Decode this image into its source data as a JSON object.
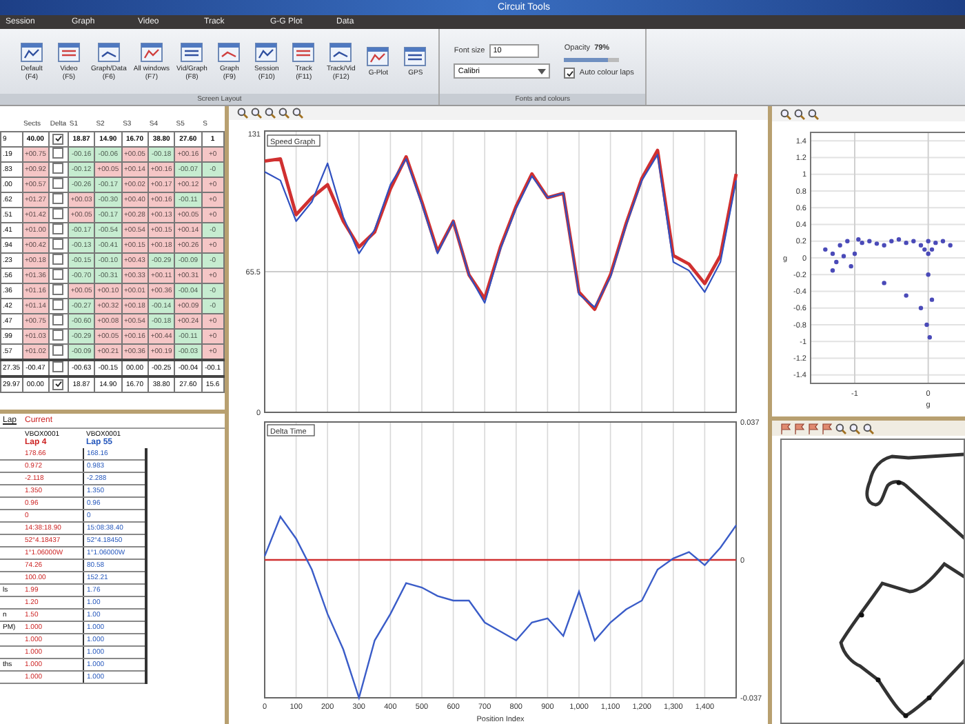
{
  "window": {
    "title": "Circuit Tools"
  },
  "menu": [
    "Session",
    "Graph",
    "Video",
    "Track",
    "G-G Plot",
    "Data"
  ],
  "layout_group": {
    "caption": "Screen Layout",
    "buttons": [
      {
        "label": "Default",
        "key": "(F4)"
      },
      {
        "label": "Video",
        "key": "(F5)"
      },
      {
        "label": "Graph/Data",
        "key": "(F6)"
      },
      {
        "label": "All windows",
        "key": "(F7)"
      },
      {
        "label": "Vid/Graph",
        "key": "(F8)"
      },
      {
        "label": "Graph",
        "key": "(F9)"
      },
      {
        "label": "Session",
        "key": "(F10)"
      },
      {
        "label": "Track",
        "key": "(F11)"
      },
      {
        "label": "Track/Vid",
        "key": "(F12)"
      },
      {
        "label": "G-Plot"
      },
      {
        "label": "GPS"
      }
    ]
  },
  "fonts_group": {
    "caption": "Fonts and colours",
    "font_size_label": "Font size",
    "font_size": "10",
    "font": "Calibri",
    "opacity_label": "Opacity",
    "opacity": "79%",
    "opacity_slider": {
      "level": 0.79
    },
    "auto_colour": {
      "label": "Auto colour laps",
      "checked": true
    }
  },
  "lap_table": {
    "columns": [
      "Sects",
      "Delta",
      "S1",
      "S2",
      "S3",
      "S4",
      "S5",
      "S"
    ],
    "best": {
      "lead": "9",
      "sects": "40.00",
      "checked": true,
      "splits": [
        "18.87",
        "14.90",
        "16.70",
        "38.80",
        "27.60",
        "1"
      ]
    },
    "rows": [
      {
        "lead": ".19",
        "sects": {
          "text": "+00.75",
          "color": "#f5c6c6"
        },
        "checked": false,
        "splits": [
          {
            "text": "-00.16",
            "color": "#c6ecd0"
          },
          {
            "text": "-00.06",
            "color": "#c6ecd0"
          },
          {
            "text": "+00.05",
            "color": "#f5c6c6"
          },
          {
            "text": "-00.18",
            "color": "#c6ecd0"
          },
          {
            "text": "+00.16",
            "color": "#f5c6c6"
          },
          {
            "text": "+0",
            "color": "#f5c6c6"
          }
        ]
      },
      {
        "lead": ".83",
        "sects": {
          "text": "+00.92",
          "color": "#f5c6c6"
        },
        "checked": false,
        "splits": [
          {
            "text": "-00.12",
            "color": "#c6ecd0"
          },
          {
            "text": "+00.05",
            "color": "#f5c6c6"
          },
          {
            "text": "+00.14",
            "color": "#f5c6c6"
          },
          {
            "text": "+00.16",
            "color": "#f5c6c6"
          },
          {
            "text": "-00.07",
            "color": "#c6ecd0"
          },
          {
            "text": "-0",
            "color": "#c6ecd0"
          }
        ]
      },
      {
        "lead": ".00",
        "sects": {
          "text": "+00.57",
          "color": "#f5c6c6"
        },
        "checked": false,
        "splits": [
          {
            "text": "-00.26",
            "color": "#c6ecd0"
          },
          {
            "text": "-00.17",
            "color": "#c6ecd0"
          },
          {
            "text": "+00.02",
            "color": "#f5c6c6"
          },
          {
            "text": "+00.17",
            "color": "#f5c6c6"
          },
          {
            "text": "+00.12",
            "color": "#f5c6c6"
          },
          {
            "text": "+0",
            "color": "#f5c6c6"
          }
        ]
      },
      {
        "lead": ".62",
        "sects": {
          "text": "+01.27",
          "color": "#f5c6c6"
        },
        "checked": false,
        "splits": [
          {
            "text": "+00.03",
            "color": "#f5c6c6"
          },
          {
            "text": "-00.30",
            "color": "#c6ecd0"
          },
          {
            "text": "+00.40",
            "color": "#f5c6c6"
          },
          {
            "text": "+00.16",
            "color": "#f5c6c6"
          },
          {
            "text": "-00.11",
            "color": "#c6ecd0"
          },
          {
            "text": "+0",
            "color": "#f5c6c6"
          }
        ]
      },
      {
        "lead": ".51",
        "sects": {
          "text": "+01.42",
          "color": "#f5c6c6"
        },
        "checked": false,
        "splits": [
          {
            "text": "+00.05",
            "color": "#f5c6c6"
          },
          {
            "text": "-00.17",
            "color": "#c6ecd0"
          },
          {
            "text": "+00.28",
            "color": "#f5c6c6"
          },
          {
            "text": "+00.13",
            "color": "#f5c6c6"
          },
          {
            "text": "+00.05",
            "color": "#f5c6c6"
          },
          {
            "text": "+0",
            "color": "#f5c6c6"
          }
        ]
      },
      {
        "lead": ".41",
        "sects": {
          "text": "+01.00",
          "color": "#f5c6c6"
        },
        "checked": false,
        "splits": [
          {
            "text": "-00.17",
            "color": "#c6ecd0"
          },
          {
            "text": "-00.54",
            "color": "#c6ecd0"
          },
          {
            "text": "+00.54",
            "color": "#f5c6c6"
          },
          {
            "text": "+00.15",
            "color": "#f5c6c6"
          },
          {
            "text": "+00.14",
            "color": "#f5c6c6"
          },
          {
            "text": "-0",
            "color": "#c6ecd0"
          }
        ]
      },
      {
        "lead": ".94",
        "sects": {
          "text": "+00.42",
          "color": "#f5c6c6"
        },
        "checked": false,
        "splits": [
          {
            "text": "-00.13",
            "color": "#c6ecd0"
          },
          {
            "text": "-00.41",
            "color": "#c6ecd0"
          },
          {
            "text": "+00.15",
            "color": "#f5c6c6"
          },
          {
            "text": "+00.18",
            "color": "#f5c6c6"
          },
          {
            "text": "+00.26",
            "color": "#f5c6c6"
          },
          {
            "text": "+0",
            "color": "#f5c6c6"
          }
        ]
      },
      {
        "lead": ".23",
        "sects": {
          "text": "+00.18",
          "color": "#f5c6c6"
        },
        "checked": false,
        "splits": [
          {
            "text": "-00.15",
            "color": "#c6ecd0"
          },
          {
            "text": "-00.10",
            "color": "#c6ecd0"
          },
          {
            "text": "+00.43",
            "color": "#f5c6c6"
          },
          {
            "text": "-00.29",
            "color": "#c6ecd0"
          },
          {
            "text": "-00.09",
            "color": "#c6ecd0"
          },
          {
            "text": "-0",
            "color": "#c6ecd0"
          }
        ]
      },
      {
        "lead": ".56",
        "sects": {
          "text": "+01.36",
          "color": "#f5c6c6"
        },
        "checked": false,
        "splits": [
          {
            "text": "-00.70",
            "color": "#c6ecd0"
          },
          {
            "text": "-00.31",
            "color": "#c6ecd0"
          },
          {
            "text": "+00.33",
            "color": "#f5c6c6"
          },
          {
            "text": "+00.11",
            "color": "#f5c6c6"
          },
          {
            "text": "+00.31",
            "color": "#f5c6c6"
          },
          {
            "text": "+0",
            "color": "#f5c6c6"
          }
        ]
      },
      {
        "lead": ".36",
        "sects": {
          "text": "+01.16",
          "color": "#f5c6c6"
        },
        "checked": false,
        "splits": [
          {
            "text": "+00.05",
            "color": "#f5c6c6"
          },
          {
            "text": "+00.10",
            "color": "#f5c6c6"
          },
          {
            "text": "+00.01",
            "color": "#f5c6c6"
          },
          {
            "text": "+00.36",
            "color": "#f5c6c6"
          },
          {
            "text": "-00.04",
            "color": "#c6ecd0"
          },
          {
            "text": "-0",
            "color": "#c6ecd0"
          }
        ]
      },
      {
        "lead": ".42",
        "sects": {
          "text": "+01.14",
          "color": "#f5c6c6"
        },
        "checked": false,
        "splits": [
          {
            "text": "-00.27",
            "color": "#c6ecd0"
          },
          {
            "text": "+00.32",
            "color": "#f5c6c6"
          },
          {
            "text": "+00.18",
            "color": "#f5c6c6"
          },
          {
            "text": "-00.14",
            "color": "#c6ecd0"
          },
          {
            "text": "+00.09",
            "color": "#f5c6c6"
          },
          {
            "text": "-0",
            "color": "#c6ecd0"
          }
        ]
      },
      {
        "lead": ".47",
        "sects": {
          "text": "+00.75",
          "color": "#f5c6c6"
        },
        "checked": false,
        "splits": [
          {
            "text": "-00.60",
            "color": "#c6ecd0"
          },
          {
            "text": "+00.08",
            "color": "#f5c6c6"
          },
          {
            "text": "+00.54",
            "color": "#f5c6c6"
          },
          {
            "text": "-00.18",
            "color": "#c6ecd0"
          },
          {
            "text": "+00.24",
            "color": "#f5c6c6"
          },
          {
            "text": "+0",
            "color": "#f5c6c6"
          }
        ]
      },
      {
        "lead": ".99",
        "sects": {
          "text": "+01.03",
          "color": "#f5c6c6"
        },
        "checked": false,
        "splits": [
          {
            "text": "-00.29",
            "color": "#c6ecd0"
          },
          {
            "text": "+00.05",
            "color": "#f5c6c6"
          },
          {
            "text": "+00.16",
            "color": "#f5c6c6"
          },
          {
            "text": "+00.44",
            "color": "#f5c6c6"
          },
          {
            "text": "-00.11",
            "color": "#c6ecd0"
          },
          {
            "text": "+0",
            "color": "#f5c6c6"
          }
        ]
      },
      {
        "lead": ".57",
        "sects": {
          "text": "+01.02",
          "color": "#f5c6c6"
        },
        "checked": false,
        "splits": [
          {
            "text": "-00.09",
            "color": "#c6ecd0"
          },
          {
            "text": "+00.21",
            "color": "#f5c6c6"
          },
          {
            "text": "+00.36",
            "color": "#f5c6c6"
          },
          {
            "text": "+00.19",
            "color": "#f5c6c6"
          },
          {
            "text": "-00.03",
            "color": "#c6ecd0"
          },
          {
            "text": "+0",
            "color": "#f5c6c6"
          }
        ]
      }
    ],
    "totals": [
      {
        "lead": "27.35",
        "sects": "-00.47",
        "checked": false,
        "splits": [
          "-00.63",
          "-00.15",
          "00.00",
          "-00.25",
          "-00.04",
          "-00.1"
        ]
      },
      {
        "lead": "29.97",
        "sects": "00.00",
        "checked": true,
        "splits": [
          "18.87",
          "14.90",
          "16.70",
          "38.80",
          "27.60",
          "15.6"
        ]
      }
    ]
  },
  "compare": {
    "tabs": [
      {
        "label": "Lap",
        "selected": true
      },
      {
        "label": "Current",
        "selected": false
      }
    ],
    "headers": [
      {
        "name": "VBOX0001",
        "lap": "Lap 4",
        "color": "#cc2222"
      },
      {
        "name": "VBOX0001",
        "lap": "Lap 55",
        "color": "#2255bb"
      }
    ],
    "rows": [
      {
        "a": "178.66",
        "b": "168.16"
      },
      {
        "a": "0.972",
        "b": "0.983"
      },
      {
        "a": "-2.118",
        "b": "-2.288"
      },
      {
        "a": "1.350",
        "b": "1.350"
      },
      {
        "a": "0.96",
        "b": "0.96"
      },
      {
        "a": "0",
        "b": "0"
      },
      {
        "a": "14:38:18.90",
        "b": "15:08:38.40"
      },
      {
        "a": "52°4.18437",
        "b": "52°4.18450"
      },
      {
        "a": "1°1.06000W",
        "b": "1°1.06000W"
      },
      {
        "a": "74.26",
        "b": "80.58"
      },
      {
        "a": "100.00",
        "b": "152.21"
      },
      {
        "label": "ls",
        "a": "1.99",
        "b": "1.76"
      },
      {
        "a": "1.20",
        "b": "1.00"
      },
      {
        "label": "n",
        "a": "1.50",
        "b": "1.00"
      },
      {
        "label": "PM)",
        "a": "1.000",
        "b": "1.000"
      },
      {
        "a": "1.000",
        "b": "1.000"
      },
      {
        "a": "1.000",
        "b": "1.000"
      },
      {
        "label": "ths",
        "a": "1.000",
        "b": "1.000"
      },
      {
        "a": "1.000",
        "b": "1.000"
      }
    ]
  },
  "speed_chart": {
    "legend": "Speed Graph",
    "chart_data": {
      "type": "line",
      "x": [
        0,
        50,
        100,
        150,
        200,
        250,
        300,
        350,
        400,
        450,
        500,
        550,
        600,
        650,
        700,
        750,
        800,
        850,
        900,
        950,
        1000,
        1050,
        1100,
        1150,
        1200,
        1250,
        1300,
        1350,
        1400,
        1450,
        1500
      ],
      "xlim": [
        0,
        1500
      ],
      "ylim": [
        0,
        131
      ],
      "yticks": [
        0,
        65.5,
        131
      ],
      "grid": true,
      "ref_lines": [
        {
          "axis": "y",
          "value": 65.5
        }
      ],
      "series": [
        {
          "color": "#d03030",
          "values": [
            117,
            118,
            92,
            100,
            106,
            89,
            77,
            84,
            104,
            119,
            98,
            75,
            89,
            64,
            53,
            77,
            96,
            111,
            100,
            102,
            56,
            48,
            64,
            88,
            109,
            122,
            73,
            69,
            60,
            73,
            111
          ]
        },
        {
          "color": "#3050c0",
          "values": [
            112,
            108,
            89,
            98,
            116,
            91,
            74,
            85,
            106,
            118,
            97,
            74,
            89,
            64,
            51,
            76,
            95,
            110,
            100,
            102,
            55,
            49,
            63,
            87,
            108,
            120,
            70,
            66,
            56,
            70,
            108
          ]
        }
      ]
    }
  },
  "delta_chart": {
    "legend": "Delta Time",
    "chart_data": {
      "type": "line",
      "x": [
        0,
        50,
        100,
        150,
        200,
        250,
        300,
        350,
        400,
        450,
        500,
        550,
        600,
        650,
        700,
        750,
        800,
        850,
        900,
        950,
        1000,
        1050,
        1100,
        1150,
        1200,
        1250,
        1300,
        1350,
        1400,
        1450,
        1500
      ],
      "xlim": [
        0,
        1500
      ],
      "ylim": [
        -0.037,
        0.037
      ],
      "xlabel": "Position Index",
      "yticks": [
        -0.037,
        0,
        0.037
      ],
      "grid": true,
      "xticks": [
        0,
        100,
        200,
        300,
        400,
        500,
        600,
        700,
        800,
        900,
        {
          "value": 1000,
          "label": "1,000"
        },
        {
          "value": 1100,
          "label": "1,100"
        },
        {
          "value": 1200,
          "label": "1,200"
        },
        {
          "value": 1300,
          "label": "1,300"
        },
        {
          "value": 1400,
          "label": "1,400"
        }
      ],
      "series": [
        {
          "color": "#d03030",
          "values": [
            0,
            0,
            0,
            0,
            0,
            0,
            0,
            0,
            0,
            0,
            0,
            0,
            0,
            0,
            0,
            0,
            0,
            0,
            0,
            0,
            0,
            0,
            0,
            0,
            0,
            0,
            0,
            0,
            0,
            0,
            0
          ]
        },
        {
          "color": "#3a5cc8",
          "values": [
            0.001,
            0.0116,
            0.0057,
            -0.0026,
            -0.0145,
            -0.024,
            -0.037,
            -0.0216,
            -0.0145,
            -0.0062,
            -0.0074,
            -0.0097,
            -0.0109,
            -0.0109,
            -0.0168,
            -0.0192,
            -0.0216,
            -0.0168,
            -0.0157,
            -0.0204,
            -0.0085,
            -0.0216,
            -0.0168,
            -0.0133,
            -0.0109,
            -0.0026,
            0.0004,
            0.0021,
            -0.0014,
            0.0033,
            0.0093
          ]
        }
      ]
    }
  },
  "gg_chart": {
    "chart_data": {
      "type": "scatter",
      "xlabel": "g",
      "ylabel": "g",
      "xlim": [
        -1.6,
        0.5
      ],
      "ylim": [
        -1.5,
        1.5
      ],
      "grid": true,
      "xticks": [
        -1,
        0
      ],
      "yticks": [
        -1.4,
        -1.2,
        -1,
        -0.8,
        -0.6,
        -0.4,
        -0.2,
        0,
        0.2,
        0.4,
        0.6,
        0.8,
        1,
        1.2,
        1.4
      ],
      "x": [
        -1.4,
        -1.3,
        -1.25,
        -1.2,
        -1.1,
        -1.05,
        -1,
        -0.95,
        -0.9,
        -0.8,
        -0.7,
        -0.6,
        -0.5,
        -0.4,
        -0.3,
        -0.2,
        -0.1,
        -0.05,
        0,
        0,
        0,
        0.05,
        0.1,
        0.2,
        0.3,
        -0.6,
        -0.3,
        -0.1,
        0.05,
        -0.02,
        0.02,
        -1.3,
        -1.15
      ],
      "series": [
        {
          "color": "#4a4ab8",
          "values": [
            0.1,
            0.05,
            -0.05,
            0.15,
            0.2,
            -0.1,
            0.05,
            0.22,
            0.18,
            0.2,
            0.17,
            0.15,
            0.2,
            0.22,
            0.18,
            0.2,
            0.15,
            0.1,
            0.2,
            0.05,
            -0.2,
            0.1,
            0.18,
            0.2,
            0.15,
            -0.3,
            -0.45,
            -0.6,
            -0.5,
            -0.8,
            -0.95,
            -0.15,
            0.02
          ]
        }
      ]
    }
  }
}
